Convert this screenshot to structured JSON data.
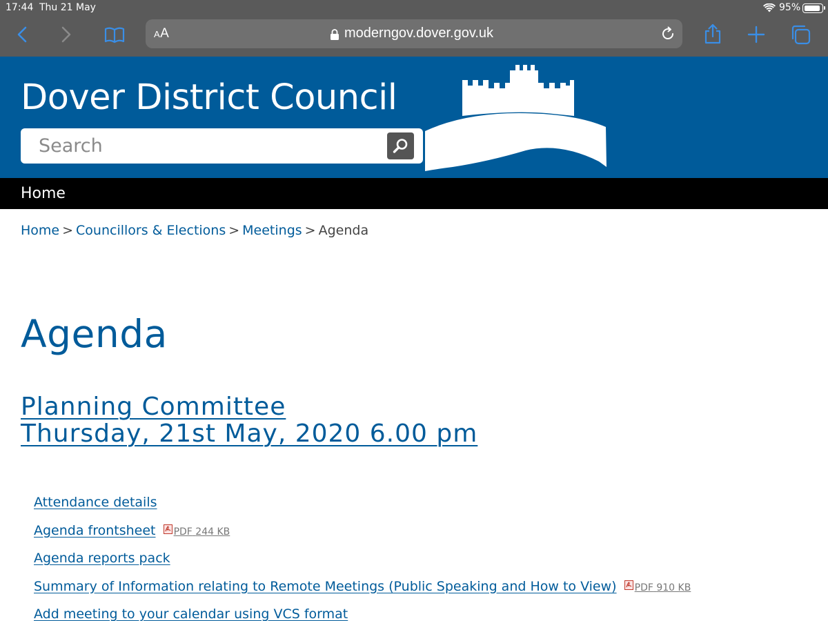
{
  "status_bar": {
    "time": "17:44",
    "date": "Thu 21 May",
    "battery": "95%"
  },
  "browser": {
    "text_size_label_small": "A",
    "text_size_label_large": "A",
    "url": "moderngov.dover.gov.uk"
  },
  "header": {
    "site_title": "Dover District Council",
    "search_placeholder": "Search"
  },
  "nav": {
    "home": "Home"
  },
  "breadcrumb": {
    "items": [
      "Home",
      "Councillors & Elections",
      "Meetings",
      "Agenda"
    ],
    "separator": ">"
  },
  "page": {
    "title": "Agenda",
    "meeting_name": "Planning Committee",
    "meeting_datetime": "Thursday, 21st May, 2020 6.00 pm"
  },
  "documents": [
    {
      "label": "Attendance details"
    },
    {
      "label": "Agenda frontsheet",
      "file_type": "PDF",
      "size": "244 KB"
    },
    {
      "label": "Agenda reports pack"
    },
    {
      "label": "Summary of Information relating to Remote Meetings (Public Speaking and How to View)",
      "file_type": "PDF",
      "size": "910 KB"
    },
    {
      "label": "Add meeting to your calendar using VCS format"
    }
  ],
  "colors": {
    "brand_blue": "#005b9a",
    "browser_chrome": "#5a5a5a",
    "ios_accent": "#3a8ee6"
  }
}
